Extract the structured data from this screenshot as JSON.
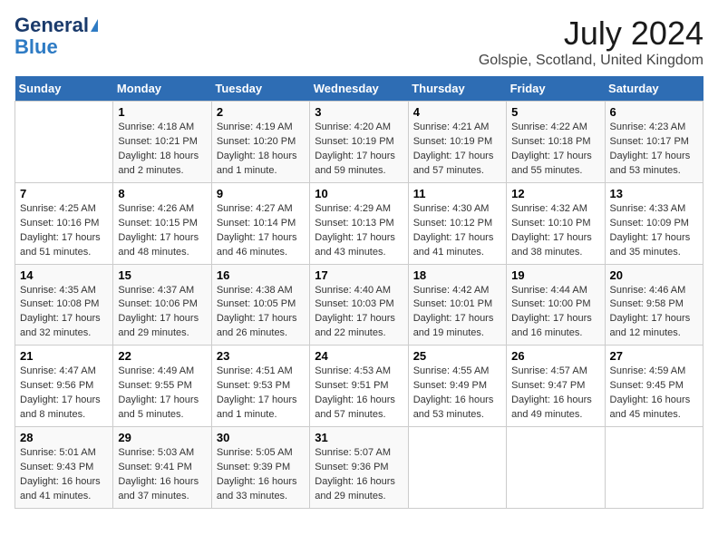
{
  "logo": {
    "line1": "General",
    "line2": "Blue"
  },
  "title": "July 2024",
  "subtitle": "Golspie, Scotland, United Kingdom",
  "headers": [
    "Sunday",
    "Monday",
    "Tuesday",
    "Wednesday",
    "Thursday",
    "Friday",
    "Saturday"
  ],
  "weeks": [
    [
      {
        "day": "",
        "info": ""
      },
      {
        "day": "1",
        "info": "Sunrise: 4:18 AM\nSunset: 10:21 PM\nDaylight: 18 hours\nand 2 minutes."
      },
      {
        "day": "2",
        "info": "Sunrise: 4:19 AM\nSunset: 10:20 PM\nDaylight: 18 hours\nand 1 minute."
      },
      {
        "day": "3",
        "info": "Sunrise: 4:20 AM\nSunset: 10:19 PM\nDaylight: 17 hours\nand 59 minutes."
      },
      {
        "day": "4",
        "info": "Sunrise: 4:21 AM\nSunset: 10:19 PM\nDaylight: 17 hours\nand 57 minutes."
      },
      {
        "day": "5",
        "info": "Sunrise: 4:22 AM\nSunset: 10:18 PM\nDaylight: 17 hours\nand 55 minutes."
      },
      {
        "day": "6",
        "info": "Sunrise: 4:23 AM\nSunset: 10:17 PM\nDaylight: 17 hours\nand 53 minutes."
      }
    ],
    [
      {
        "day": "7",
        "info": "Sunrise: 4:25 AM\nSunset: 10:16 PM\nDaylight: 17 hours\nand 51 minutes."
      },
      {
        "day": "8",
        "info": "Sunrise: 4:26 AM\nSunset: 10:15 PM\nDaylight: 17 hours\nand 48 minutes."
      },
      {
        "day": "9",
        "info": "Sunrise: 4:27 AM\nSunset: 10:14 PM\nDaylight: 17 hours\nand 46 minutes."
      },
      {
        "day": "10",
        "info": "Sunrise: 4:29 AM\nSunset: 10:13 PM\nDaylight: 17 hours\nand 43 minutes."
      },
      {
        "day": "11",
        "info": "Sunrise: 4:30 AM\nSunset: 10:12 PM\nDaylight: 17 hours\nand 41 minutes."
      },
      {
        "day": "12",
        "info": "Sunrise: 4:32 AM\nSunset: 10:10 PM\nDaylight: 17 hours\nand 38 minutes."
      },
      {
        "day": "13",
        "info": "Sunrise: 4:33 AM\nSunset: 10:09 PM\nDaylight: 17 hours\nand 35 minutes."
      }
    ],
    [
      {
        "day": "14",
        "info": "Sunrise: 4:35 AM\nSunset: 10:08 PM\nDaylight: 17 hours\nand 32 minutes."
      },
      {
        "day": "15",
        "info": "Sunrise: 4:37 AM\nSunset: 10:06 PM\nDaylight: 17 hours\nand 29 minutes."
      },
      {
        "day": "16",
        "info": "Sunrise: 4:38 AM\nSunset: 10:05 PM\nDaylight: 17 hours\nand 26 minutes."
      },
      {
        "day": "17",
        "info": "Sunrise: 4:40 AM\nSunset: 10:03 PM\nDaylight: 17 hours\nand 22 minutes."
      },
      {
        "day": "18",
        "info": "Sunrise: 4:42 AM\nSunset: 10:01 PM\nDaylight: 17 hours\nand 19 minutes."
      },
      {
        "day": "19",
        "info": "Sunrise: 4:44 AM\nSunset: 10:00 PM\nDaylight: 17 hours\nand 16 minutes."
      },
      {
        "day": "20",
        "info": "Sunrise: 4:46 AM\nSunset: 9:58 PM\nDaylight: 17 hours\nand 12 minutes."
      }
    ],
    [
      {
        "day": "21",
        "info": "Sunrise: 4:47 AM\nSunset: 9:56 PM\nDaylight: 17 hours\nand 8 minutes."
      },
      {
        "day": "22",
        "info": "Sunrise: 4:49 AM\nSunset: 9:55 PM\nDaylight: 17 hours\nand 5 minutes."
      },
      {
        "day": "23",
        "info": "Sunrise: 4:51 AM\nSunset: 9:53 PM\nDaylight: 17 hours\nand 1 minute."
      },
      {
        "day": "24",
        "info": "Sunrise: 4:53 AM\nSunset: 9:51 PM\nDaylight: 16 hours\nand 57 minutes."
      },
      {
        "day": "25",
        "info": "Sunrise: 4:55 AM\nSunset: 9:49 PM\nDaylight: 16 hours\nand 53 minutes."
      },
      {
        "day": "26",
        "info": "Sunrise: 4:57 AM\nSunset: 9:47 PM\nDaylight: 16 hours\nand 49 minutes."
      },
      {
        "day": "27",
        "info": "Sunrise: 4:59 AM\nSunset: 9:45 PM\nDaylight: 16 hours\nand 45 minutes."
      }
    ],
    [
      {
        "day": "28",
        "info": "Sunrise: 5:01 AM\nSunset: 9:43 PM\nDaylight: 16 hours\nand 41 minutes."
      },
      {
        "day": "29",
        "info": "Sunrise: 5:03 AM\nSunset: 9:41 PM\nDaylight: 16 hours\nand 37 minutes."
      },
      {
        "day": "30",
        "info": "Sunrise: 5:05 AM\nSunset: 9:39 PM\nDaylight: 16 hours\nand 33 minutes."
      },
      {
        "day": "31",
        "info": "Sunrise: 5:07 AM\nSunset: 9:36 PM\nDaylight: 16 hours\nand 29 minutes."
      },
      {
        "day": "",
        "info": ""
      },
      {
        "day": "",
        "info": ""
      },
      {
        "day": "",
        "info": ""
      }
    ]
  ]
}
